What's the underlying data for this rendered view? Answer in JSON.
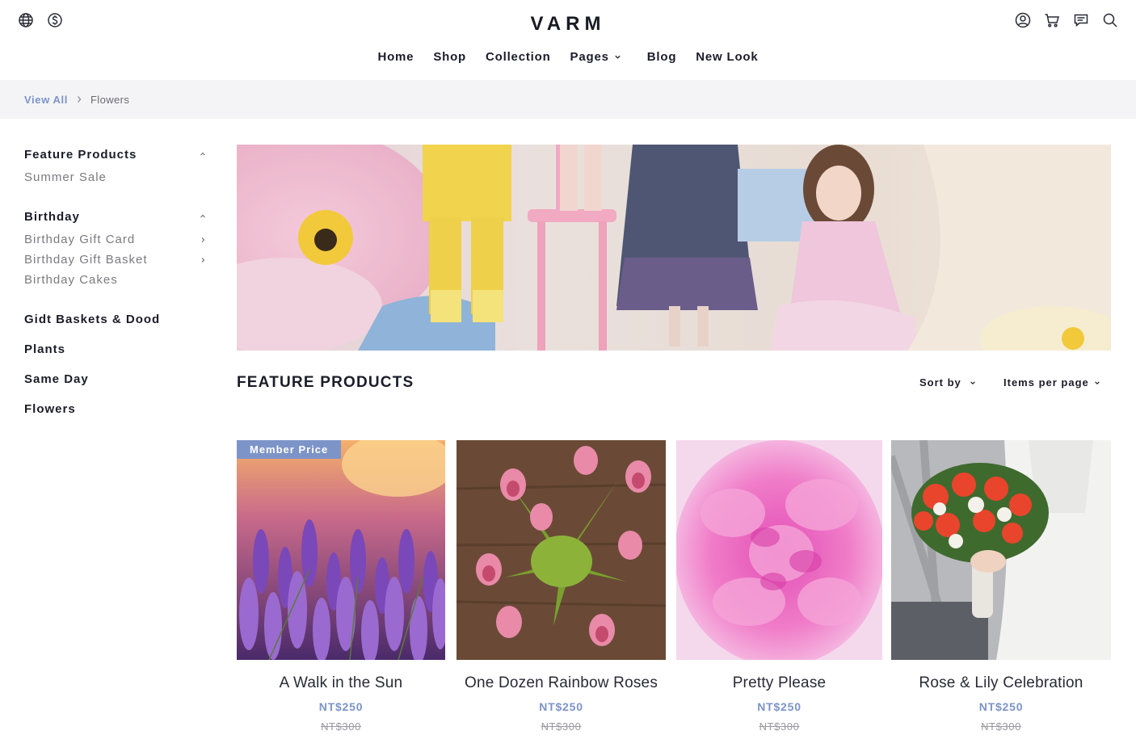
{
  "header": {
    "logo": "VARM",
    "left_icons": [
      "globe-icon",
      "dollar-icon"
    ],
    "right_icons": [
      "account-icon",
      "cart-icon",
      "message-icon",
      "search-icon"
    ]
  },
  "nav": {
    "items": [
      {
        "label": "Home"
      },
      {
        "label": "Shop"
      },
      {
        "label": "Collection"
      },
      {
        "label": "Pages",
        "has_dropdown": true
      },
      {
        "label": "Blog"
      },
      {
        "label": "New Look"
      }
    ]
  },
  "breadcrumb": {
    "root": "View All",
    "current": "Flowers"
  },
  "sidebar": {
    "groups": [
      {
        "label": "Feature Products",
        "expanded": true,
        "children": [
          {
            "label": "Summer Sale",
            "has_children": false
          }
        ]
      },
      {
        "label": "Birthday",
        "expanded": true,
        "children": [
          {
            "label": "Birthday Gift Card",
            "has_children": true
          },
          {
            "label": "Birthday Gift Basket",
            "has_children": true
          },
          {
            "label": "Birthday Cakes",
            "has_children": false
          }
        ]
      }
    ],
    "plain_items": [
      "Gidt Baskets & Dood",
      "Plants",
      "Same Day",
      "Flowers"
    ]
  },
  "products_section": {
    "title": "FEATURE PRODUCTS",
    "sort_label": "Sort by",
    "per_page_label": "Items per page"
  },
  "products": [
    {
      "name": "A Walk in the Sun",
      "price": "NT$250",
      "old_price": "NT$300",
      "badge": "Member Price"
    },
    {
      "name": "One Dozen Rainbow Roses",
      "price": "NT$250",
      "old_price": "NT$300"
    },
    {
      "name": "Pretty Please",
      "price": "NT$250",
      "old_price": "NT$300"
    },
    {
      "name": "Rose & Lily Celebration",
      "price": "NT$250",
      "old_price": "NT$300"
    }
  ],
  "colors": {
    "accent": "#7c94c8",
    "text": "#1c1c2a",
    "muted": "#7a7a82",
    "crumb_bg": "#f4f4f6"
  }
}
